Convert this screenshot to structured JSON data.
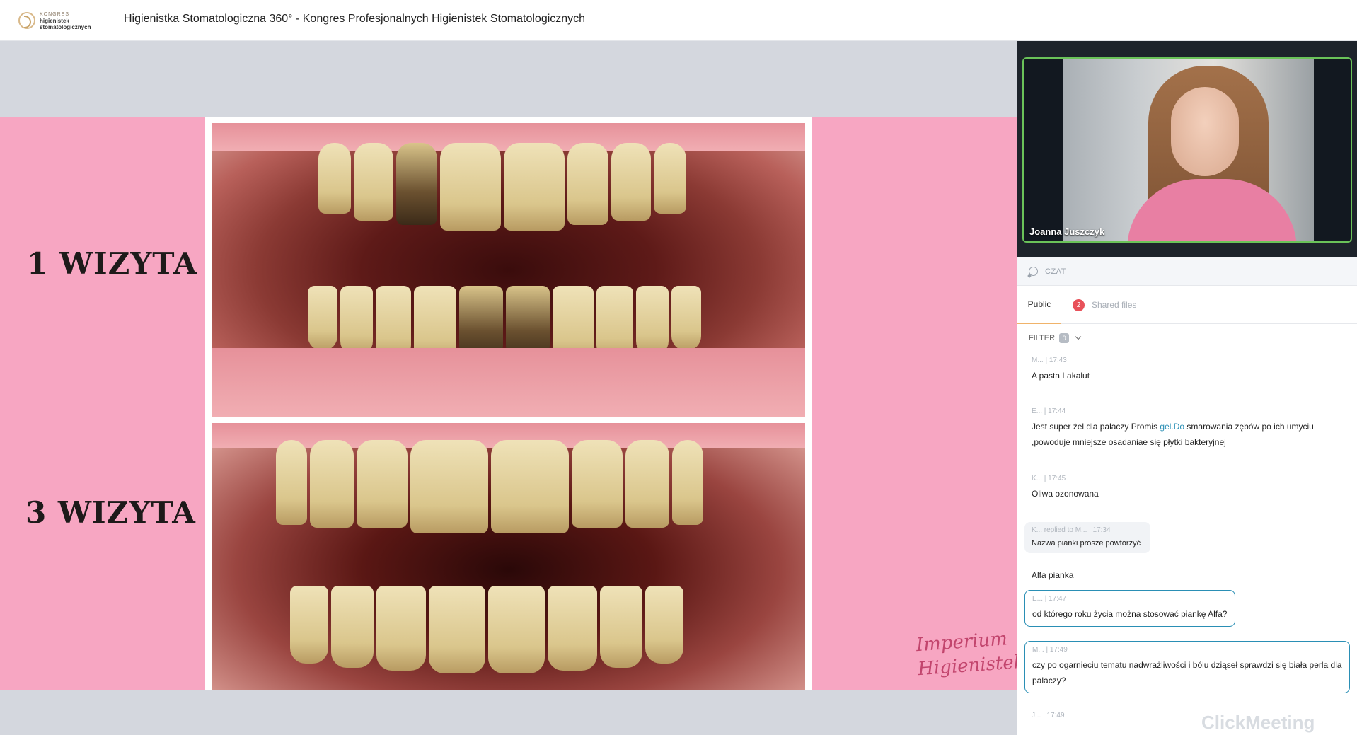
{
  "header": {
    "logo": {
      "line1": "KONGRES",
      "line2": "higienistek",
      "line3": "stomatologicznych"
    },
    "title": "Higienistka Stomatologiczna 360° - Kongres Profesjonalnych Higienistek Stomatologicznych"
  },
  "slide": {
    "label_top": "1 WIZYTA",
    "label_bottom": "3 WIZYTA",
    "brand_line1": "Imperium",
    "brand_line2": "Higienistek",
    "colors": {
      "background": "#f7a6c2",
      "stage": "#d4d7de"
    }
  },
  "video": {
    "presenter_name": "Joanna Juszczyk",
    "active_border_color": "#6ac259"
  },
  "chat": {
    "header_label": "CZAT",
    "tabs": [
      {
        "label": "Public",
        "active": true
      },
      {
        "label": "Shared files",
        "badge": "2",
        "active": false
      }
    ],
    "filter": {
      "label": "FILTER",
      "count": "0"
    },
    "messages": [
      {
        "meta": "M... | 17:43",
        "text": "A pasta Lakalut"
      },
      {
        "meta": "E... | 17:44",
        "text_before": "Jest super żel dla palaczy Promis ",
        "link": "gel.Do",
        "text_after": " smarowania zębów po ich  umyciu ,powoduje mniejsze osadaniae się płytki bakteryjnej"
      },
      {
        "meta": "K... | 17:45",
        "text": "Oliwa ozonowana"
      },
      {
        "meta": "K... replied to M... | 17:34",
        "quote": "Nazwa pianki prosze powtórzyć",
        "text": "Alfa pianka"
      },
      {
        "meta": "E... | 17:47",
        "text": "od którego roku życia można stosować piankę Alfa?"
      },
      {
        "meta": "M... | 17:49",
        "text": "czy po ogarnieciu tematu nadwrażliwości i bólu dziąseł sprawdzi się biała perla dla palaczy?"
      },
      {
        "meta": "J... | 17:49"
      }
    ],
    "accent_color": "#2a8fb5"
  },
  "watermark": "ClickMeeting"
}
